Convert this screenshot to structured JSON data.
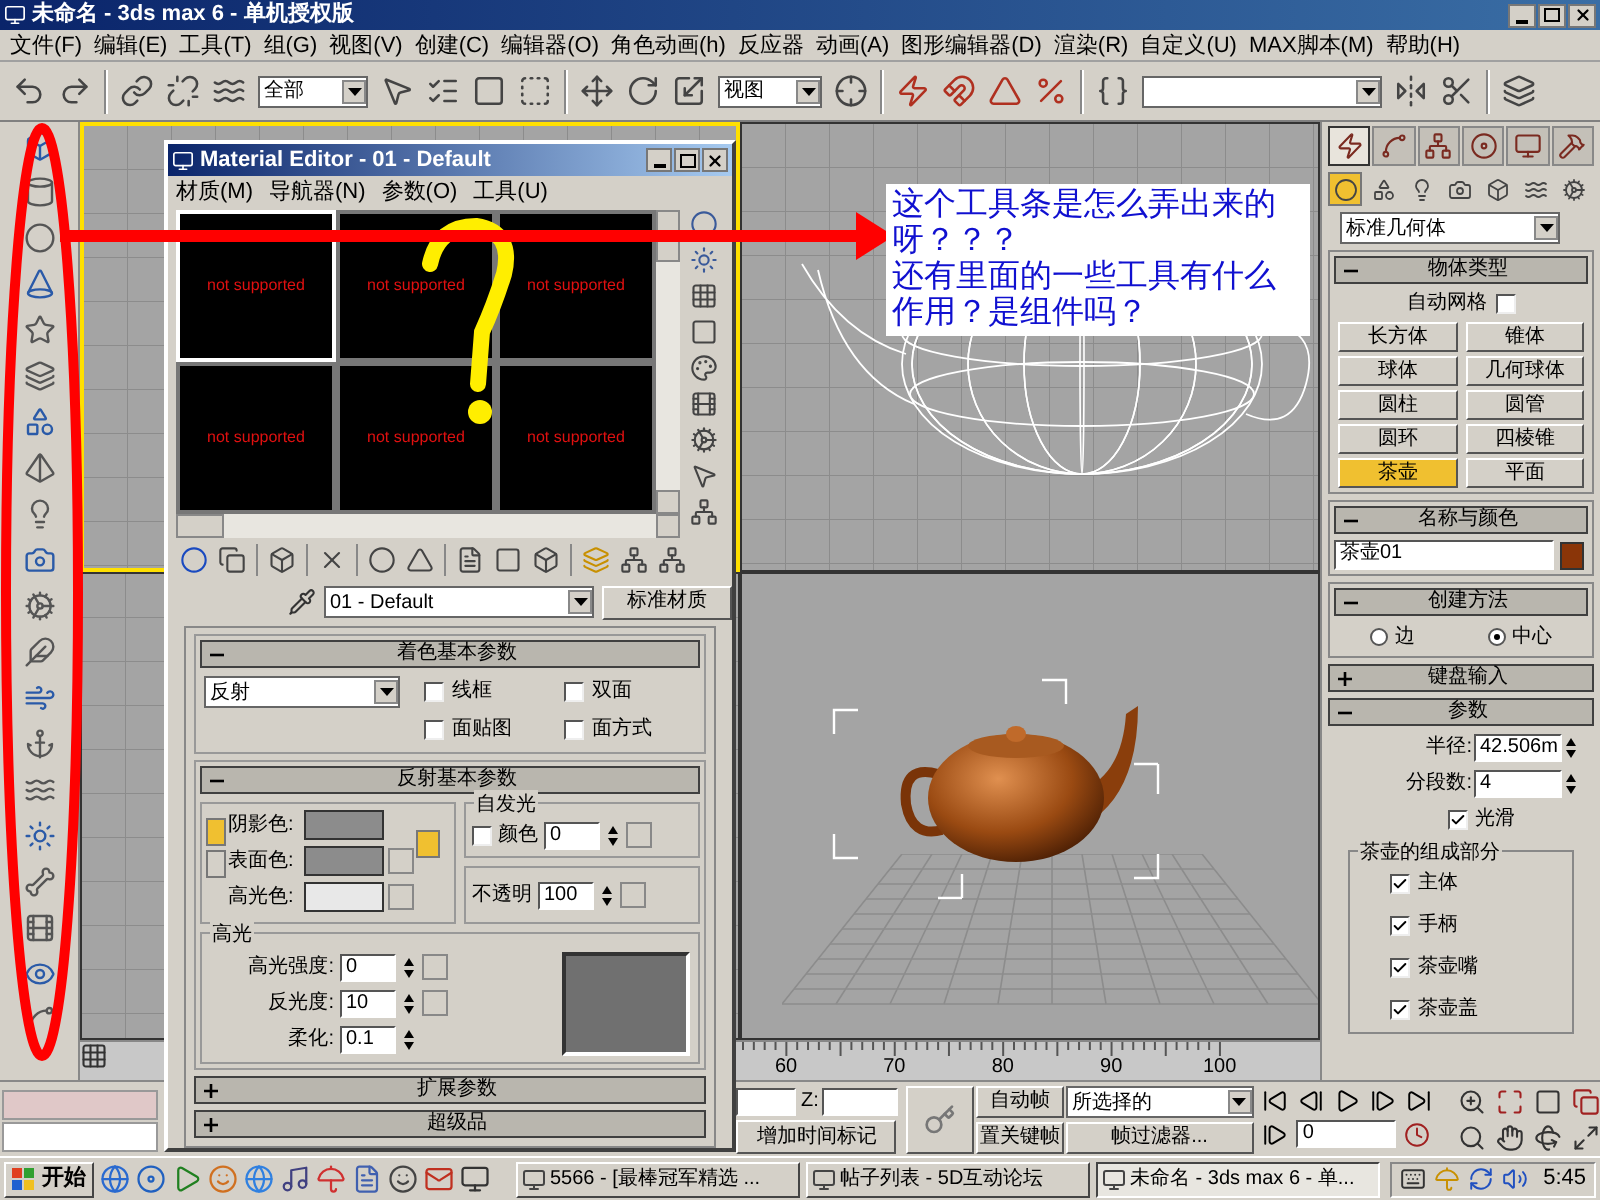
{
  "window": {
    "title": "未命名 - 3ds max 6 - 单机授权版"
  },
  "menu": [
    "文件(F)",
    "编辑(E)",
    "工具(T)",
    "组(G)",
    "视图(V)",
    "创建(C)",
    "编辑器(O)",
    "角色动画(h)",
    "反应器",
    "动画(A)",
    "图形编辑器(D)",
    "渲染(R)",
    "自定义(U)",
    "MAX脚本(M)",
    "帮助(H)"
  ],
  "toolbar": {
    "selection_filter": "全部",
    "reference_coordinates": "视图"
  },
  "viewports": [
    {
      "active": true
    },
    {
      "active": false
    },
    {
      "active": false
    },
    {
      "active": false
    }
  ],
  "timeline": {
    "ticks": [
      "60",
      "70",
      "80",
      "90",
      "100"
    ]
  },
  "material_editor": {
    "title": "Material Editor - 01 - Default",
    "menu": [
      "材质(M)",
      "导航器(N)",
      "参数(O)",
      "工具(U)"
    ],
    "slots": [
      {
        "label": "not supported",
        "selected": true
      },
      {
        "label": "not supported",
        "selected": false
      },
      {
        "label": "not supported",
        "selected": false
      },
      {
        "label": "not supported",
        "selected": false
      },
      {
        "label": "not supported",
        "selected": false
      },
      {
        "label": "not supported",
        "selected": false
      }
    ],
    "material_name": "01 - Default",
    "material_type": "标准材质",
    "shader_rollout": {
      "title": "着色基本参数",
      "expanded": true,
      "shader": "反射",
      "options": [
        {
          "label": "线框",
          "checked": false
        },
        {
          "label": "双面",
          "checked": false
        },
        {
          "label": "面贴图",
          "checked": false
        },
        {
          "label": "面方式",
          "checked": false
        }
      ]
    },
    "basic_rollout": {
      "title": "反射基本参数",
      "expanded": true,
      "colors": [
        {
          "label": "阴影色:",
          "color": "#8c8c8c"
        },
        {
          "label": "表面色:",
          "color": "#8c8c8c"
        },
        {
          "label": "高光色:",
          "color": "#e8e8e8"
        }
      ],
      "self_illumination": {
        "title": "自发光",
        "label": "颜色",
        "checked": false,
        "value": "0"
      },
      "opacity": {
        "label": "不透明",
        "value": "100"
      },
      "specular": {
        "title": "高光",
        "fields": [
          {
            "label": "高光强度:",
            "value": "0"
          },
          {
            "label": "反光度:",
            "value": "10"
          },
          {
            "label": "柔化:",
            "value": "0.1"
          }
        ]
      }
    },
    "collapsed_rollouts": [
      {
        "title": "扩展参数",
        "expanded": false
      },
      {
        "title": "超级品",
        "expanded": false
      }
    ]
  },
  "annotation": {
    "lines": [
      "这个工具条是怎么弄出来的呀？？？",
      "还有里面的一些工具有什么作用？是组件吗？"
    ]
  },
  "command_panel": {
    "tabs": [
      {
        "selected": true
      },
      {
        "selected": false
      },
      {
        "selected": false
      },
      {
        "selected": false
      },
      {
        "selected": false
      },
      {
        "selected": false
      }
    ],
    "categories": [
      {
        "selected": true
      },
      {
        "selected": false
      },
      {
        "selected": false
      },
      {
        "selected": false
      },
      {
        "selected": false
      },
      {
        "selected": false
      },
      {
        "selected": false
      }
    ],
    "object_class": "标准几何体",
    "object_type": {
      "title": "物体类型",
      "expanded": true,
      "autogrid": {
        "label": "自动网格",
        "checked": false
      },
      "buttons": [
        {
          "label": "长方体",
          "selected": false
        },
        {
          "label": "锥体",
          "selected": false
        },
        {
          "label": "球体",
          "selected": false
        },
        {
          "label": "几何球体",
          "selected": false
        },
        {
          "label": "圆柱",
          "selected": false
        },
        {
          "label": "圆管",
          "selected": false
        },
        {
          "label": "圆环",
          "selected": false
        },
        {
          "label": "四棱锥",
          "selected": false
        },
        {
          "label": "茶壶",
          "selected": true
        },
        {
          "label": "平面",
          "selected": false
        }
      ]
    },
    "name_color": {
      "title": "名称与颜色",
      "expanded": true,
      "name": "茶壶01",
      "color": "#8a3508"
    },
    "creation_method": {
      "title": "创建方法",
      "expanded": true,
      "options": [
        {
          "label": "边",
          "selected": false
        },
        {
          "label": "中心",
          "selected": true
        }
      ]
    },
    "keyboard_entry": {
      "title": "键盘输入",
      "expanded": false
    },
    "parameters": {
      "title": "参数",
      "expanded": true,
      "radius": {
        "label": "半径:",
        "value": "42.506m"
      },
      "segments": {
        "label": "分段数:",
        "value": "4"
      },
      "smooth": {
        "label": "光滑",
        "checked": true
      },
      "parts": {
        "title": "茶壶的组成部分",
        "items": [
          {
            "label": "主体",
            "checked": true
          },
          {
            "label": "手柄",
            "checked": true
          },
          {
            "label": "茶壶嘴",
            "checked": true
          },
          {
            "label": "茶壶盖",
            "checked": true
          }
        ]
      }
    }
  },
  "animation_controls": {
    "z_label": "Z:",
    "add_time_tag": "增加时间标记",
    "auto_key": "自动帧",
    "set_key": "置关键帧",
    "key_selection": "所选择的",
    "key_filters": "帧过滤器...",
    "current_frame": "0"
  },
  "taskbar": {
    "start": "开始",
    "tasks": [
      {
        "label": "5566 - [最棒冠军精选 ...",
        "selected": false
      },
      {
        "label": "帖子列表 - 5D互动论坛",
        "selected": false
      },
      {
        "label": "未命名 - 3ds max 6 - 单...",
        "selected": true
      }
    ],
    "clock": "5:45"
  }
}
